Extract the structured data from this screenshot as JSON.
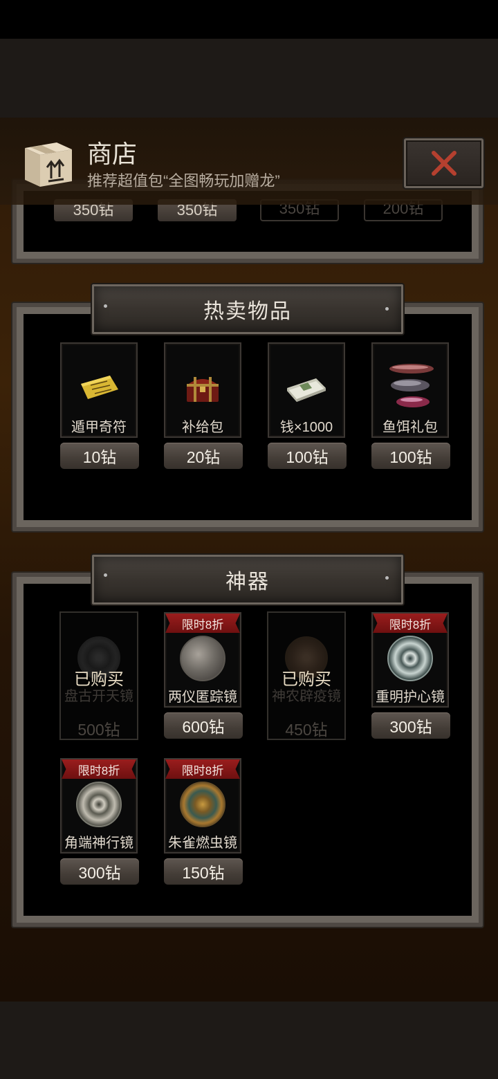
{
  "header": {
    "title": "商店",
    "subtitle": "推荐超值包“全图畅玩加赠龙”"
  },
  "partial_prices": [
    "350钻",
    "350钻",
    "350钻",
    "200钻"
  ],
  "hot_section": {
    "title": "热卖物品",
    "items": [
      {
        "name": "遁甲奇符",
        "price": "10钻",
        "icon": "talisman-icon"
      },
      {
        "name": "补给包",
        "price": "20钻",
        "icon": "chest-icon"
      },
      {
        "name": "钱×1000",
        "price": "100钻",
        "icon": "money-icon"
      },
      {
        "name": "鱼饵礼包",
        "price": "100钻",
        "icon": "fishing-lure-icon"
      }
    ]
  },
  "artifact_section": {
    "title": "神器",
    "items": [
      {
        "name": "盘古开天镜",
        "price": "500钻",
        "status": "已购买"
      },
      {
        "name": "两仪匿踪镜",
        "price": "600钻",
        "ribbon": "限时8折"
      },
      {
        "name": "神农辟疫镜",
        "price": "450钻",
        "status": "已购买"
      },
      {
        "name": "重明护心镜",
        "price": "300钻",
        "ribbon": "限时8折"
      },
      {
        "name": "角端神行镜",
        "price": "300钻",
        "ribbon": "限时8折"
      },
      {
        "name": "朱雀燃虫镜",
        "price": "150钻",
        "ribbon": "限时8折"
      }
    ]
  },
  "colors": {
    "ribbon": "#8a1a1a",
    "close_x": "#b5402f",
    "panel_frame": "#6b655e"
  }
}
